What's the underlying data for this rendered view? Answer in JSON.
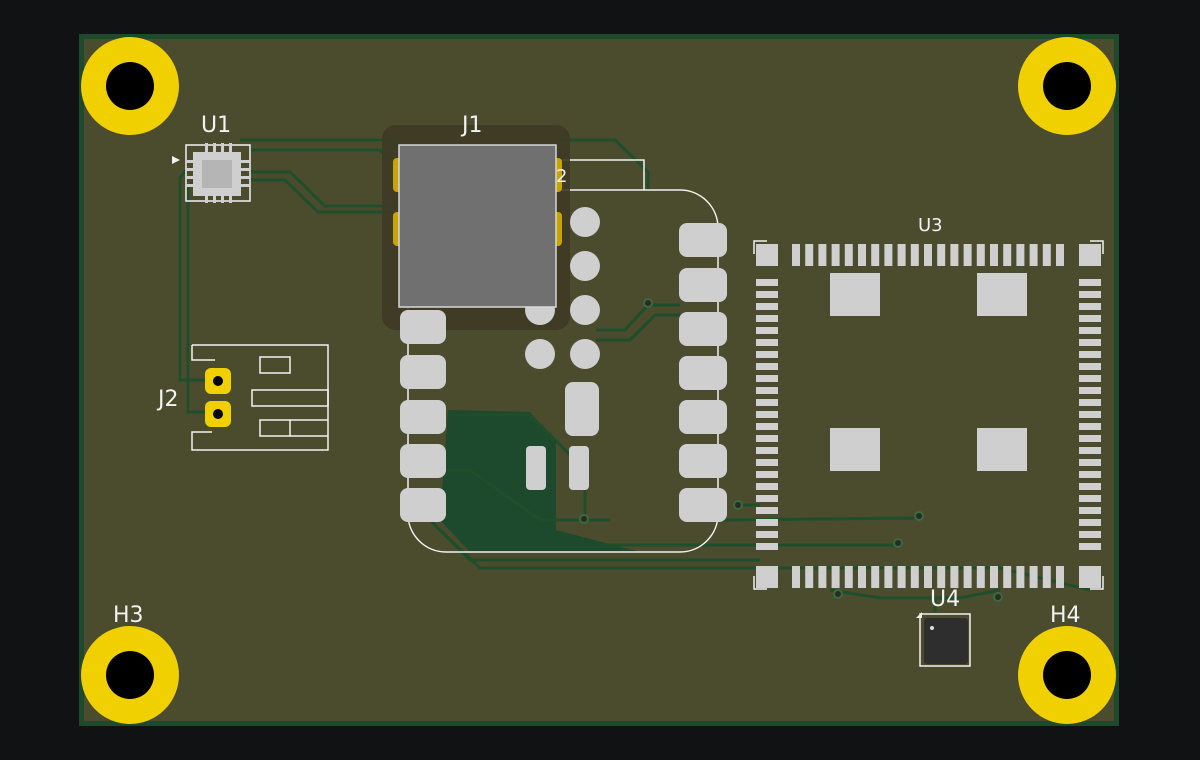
{
  "board": {
    "colors": {
      "background": "#111214",
      "substrate": "#4b4b2e",
      "edge": "#1c4a2a",
      "copper_trace": "#1f4f2a",
      "copper_pour": "#1d4a2c",
      "pad": "#cccccc",
      "silkscreen": "#f2f2f2",
      "mount_hole": "#f0d000"
    }
  },
  "designators": {
    "u1": "U1",
    "j1": "J1",
    "j2": "J2",
    "u3": "U3",
    "u4": "U4",
    "h3": "H3",
    "h4": "H4",
    "j1_pin": "2"
  }
}
